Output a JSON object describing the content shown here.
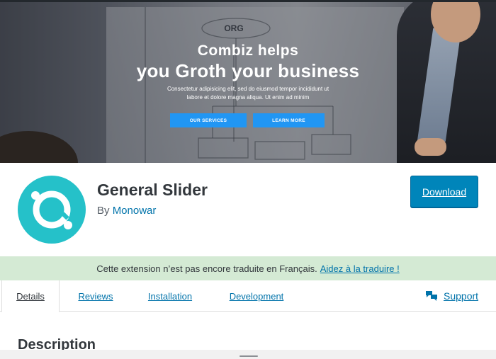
{
  "banner": {
    "board_logo": "ORG",
    "title_small": "Combiz helps",
    "title_large": "you Groth your business",
    "subtitle_line1": "Consectetur adipisicing elit, sed do eiusmod tempor incididunt ut",
    "subtitle_line2": "labore et dolore magna aliqua. Ut enim ad minim",
    "btn_services": "OUR SERVICES",
    "btn_learn": "LEARN MORE",
    "accent_color": "#2196f3"
  },
  "plugin": {
    "title": "General Slider",
    "by_label": "By",
    "author": "Monowar",
    "download_label": "Download",
    "icon_color": "#25c1c9",
    "button_color": "#0085ba"
  },
  "notice": {
    "text": "Cette extension n’est pas encore traduite en Français.",
    "link": "Aidez à la traduire !",
    "background": "#d4ead4"
  },
  "tabs": {
    "items": [
      {
        "label": "Details"
      },
      {
        "label": "Reviews"
      },
      {
        "label": "Installation"
      },
      {
        "label": "Development"
      }
    ],
    "active": "Details",
    "support_label": "Support",
    "support_icon": "speech-bubbles-icon"
  },
  "content": {
    "heading": "Description"
  }
}
